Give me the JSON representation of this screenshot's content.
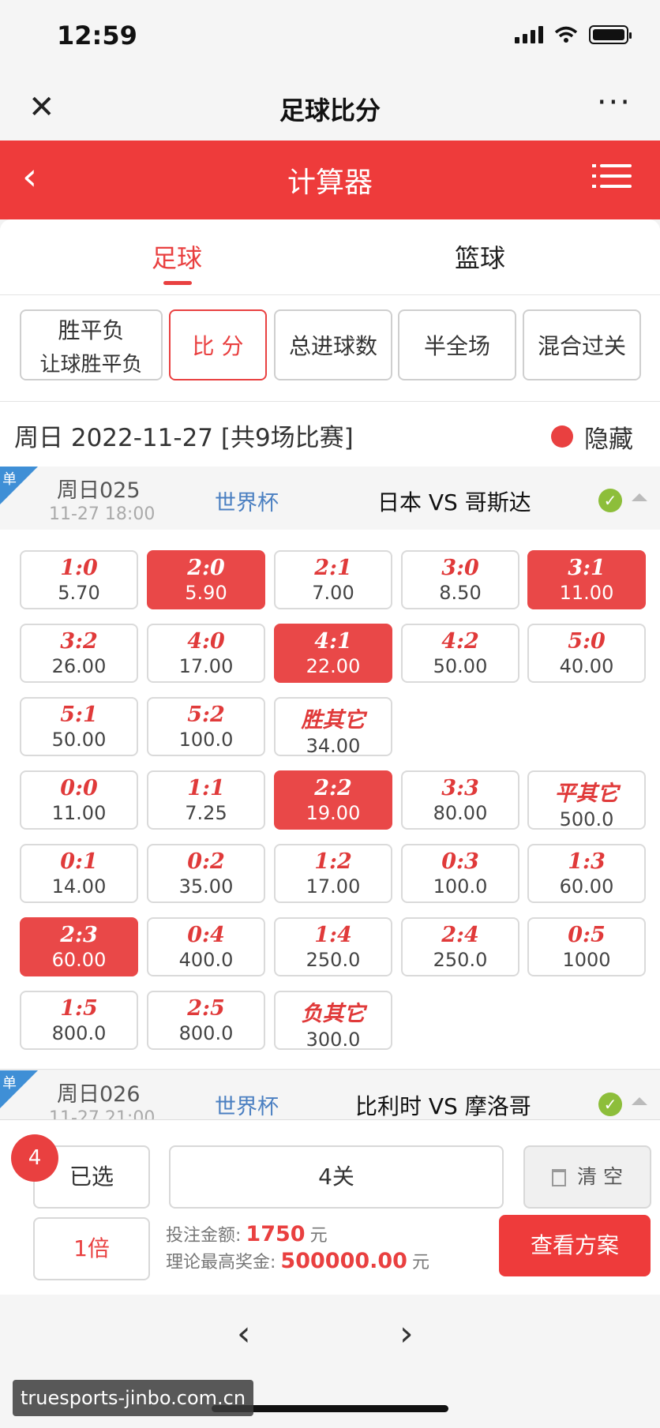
{
  "status_bar": {
    "time": "12:59"
  },
  "title_bar": {
    "title": "足球比分"
  },
  "header": {
    "title": "计算器"
  },
  "sport_tabs": [
    {
      "label": "足球",
      "active": true
    },
    {
      "label": "篮球",
      "active": false
    }
  ],
  "play_types": [
    {
      "line1": "胜平负",
      "line2": "让球胜平负",
      "active": false
    },
    {
      "line1": "比 分",
      "active": true
    },
    {
      "line1": "总进球数",
      "active": false
    },
    {
      "line1": "半全场",
      "active": false
    },
    {
      "line1": "混合过关",
      "active": false
    }
  ],
  "date_line": {
    "text": "周日 2022-11-27 [共9场比赛]",
    "hide_label": "隐藏"
  },
  "matches": [
    {
      "badge": "单",
      "number": "周日025",
      "time": "11-27 18:00",
      "league": "世界杯",
      "teams": "日本 VS 哥斯达"
    },
    {
      "badge": "单",
      "number": "周日026",
      "time": "11-27 21:00",
      "league": "世界杯",
      "teams": "比利时 VS 摩洛哥"
    }
  ],
  "odds_rows": [
    [
      {
        "score": "1:0",
        "odds": "5.70",
        "selected": false
      },
      {
        "score": "2:0",
        "odds": "5.90",
        "selected": true
      },
      {
        "score": "2:1",
        "odds": "7.00",
        "selected": false
      },
      {
        "score": "3:0",
        "odds": "8.50",
        "selected": false
      },
      {
        "score": "3:1",
        "odds": "11.00",
        "selected": true
      }
    ],
    [
      {
        "score": "3:2",
        "odds": "26.00",
        "selected": false
      },
      {
        "score": "4:0",
        "odds": "17.00",
        "selected": false
      },
      {
        "score": "4:1",
        "odds": "22.00",
        "selected": true
      },
      {
        "score": "4:2",
        "odds": "50.00",
        "selected": false
      },
      {
        "score": "5:0",
        "odds": "40.00",
        "selected": false
      }
    ],
    [
      {
        "score": "5:1",
        "odds": "50.00",
        "selected": false
      },
      {
        "score": "5:2",
        "odds": "100.0",
        "selected": false
      },
      {
        "score": "胜其它",
        "odds": "34.00",
        "selected": false
      }
    ],
    [
      {
        "score": "0:0",
        "odds": "11.00",
        "selected": false
      },
      {
        "score": "1:1",
        "odds": "7.25",
        "selected": false
      },
      {
        "score": "2:2",
        "odds": "19.00",
        "selected": true
      },
      {
        "score": "3:3",
        "odds": "80.00",
        "selected": false
      },
      {
        "score": "平其它",
        "odds": "500.0",
        "selected": false
      }
    ],
    [
      {
        "score": "0:1",
        "odds": "14.00",
        "selected": false
      },
      {
        "score": "0:2",
        "odds": "35.00",
        "selected": false
      },
      {
        "score": "1:2",
        "odds": "17.00",
        "selected": false
      },
      {
        "score": "0:3",
        "odds": "100.0",
        "selected": false
      },
      {
        "score": "1:3",
        "odds": "60.00",
        "selected": false
      }
    ],
    [
      {
        "score": "2:3",
        "odds": "60.00",
        "selected": true
      },
      {
        "score": "0:4",
        "odds": "400.0",
        "selected": false
      },
      {
        "score": "1:4",
        "odds": "250.0",
        "selected": false
      },
      {
        "score": "2:4",
        "odds": "250.0",
        "selected": false
      },
      {
        "score": "0:5",
        "odds": "1000",
        "selected": false
      }
    ],
    [
      {
        "score": "1:5",
        "odds": "800.0",
        "selected": false
      },
      {
        "score": "2:5",
        "odds": "800.0",
        "selected": false
      },
      {
        "score": "负其它",
        "odds": "300.0",
        "selected": false
      }
    ]
  ],
  "bottom": {
    "selected_count": "4",
    "selected_label": "已选",
    "pass_label": "4关",
    "clear_label": "清 空",
    "multiplier": "1倍",
    "bet_amount_label": "投注金额:",
    "bet_amount": "1750",
    "bet_unit": "元",
    "max_prize_label": "理论最高奖金:",
    "max_prize": "500000.00",
    "prize_unit": "元",
    "view_plan": "查看方案"
  },
  "nav": {
    "prev": "‹",
    "next": "›"
  },
  "watermark": "truesports-jinbo.com.cn",
  "colors": {
    "accent": "#ee3b3b",
    "league": "#4a7fc1",
    "check": "#8dbe3a"
  }
}
